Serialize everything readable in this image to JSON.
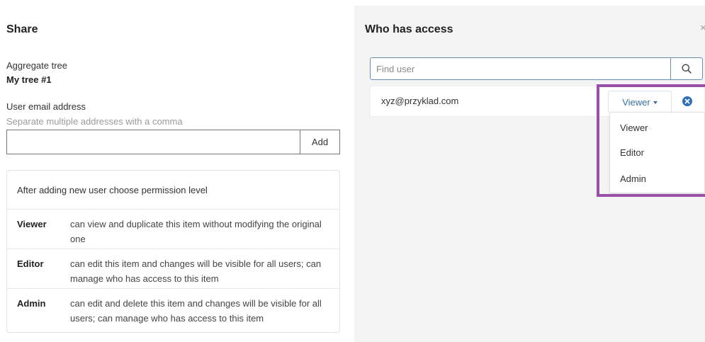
{
  "share": {
    "title": "Share",
    "aggregate_label": "Aggregate tree",
    "tree_name": "My tree #1",
    "email_label": "User email address",
    "email_hint": "Separate multiple addresses with a comma",
    "email_value": "",
    "add_label": "Add"
  },
  "permissions": {
    "intro": "After adding new user choose permission level",
    "levels": [
      {
        "name": "Viewer",
        "desc": "can view and duplicate this item without modifying the original one"
      },
      {
        "name": "Editor",
        "desc": "can edit this item and changes will be visible for all users; can manage who has access to this item"
      },
      {
        "name": "Admin",
        "desc": "can edit and delete this item and changes will be visible for all users; can manage who has access to this item"
      }
    ]
  },
  "access": {
    "title": "Who has access",
    "close_glyph": "×",
    "search_placeholder": "Find user",
    "users": [
      {
        "email": "xyz@przyklad.com",
        "role": "Viewer"
      }
    ],
    "role_options": [
      "Viewer",
      "Editor",
      "Admin"
    ]
  },
  "colors": {
    "accent": "#3a6ea5",
    "highlight": "#9a4fa8",
    "panel_bg": "#f4f4f4"
  },
  "icons": {
    "search": "search-icon",
    "remove": "remove-circle-icon",
    "caret": "caret-down-icon",
    "close": "close-icon"
  }
}
